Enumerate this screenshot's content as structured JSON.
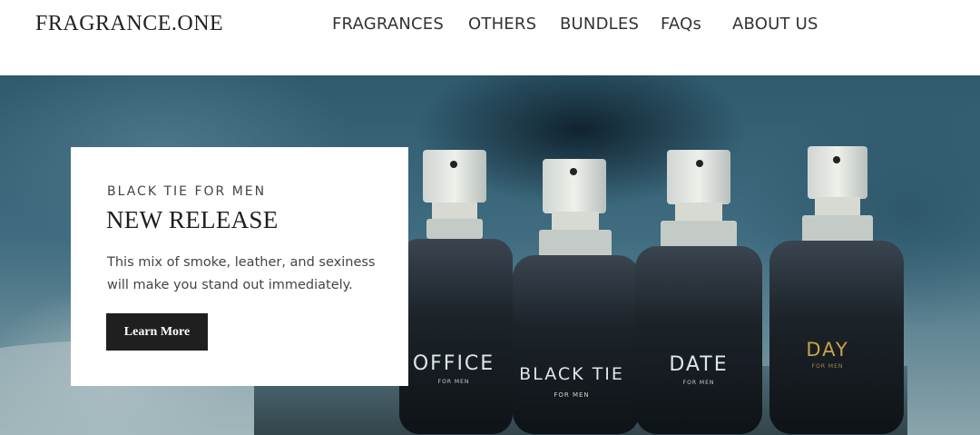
{
  "header": {
    "logo": "FRAGRANCE.ONE",
    "nav": [
      "FRAGRANCES",
      "OTHERS",
      "BUNDLES",
      "FAQs",
      "ABOUT US"
    ]
  },
  "hero": {
    "bottle_labels": [
      {
        "name": "OFFICE",
        "sub": "FOR MEN"
      },
      {
        "name": "BLACK TIE",
        "sub": "FOR MEN"
      },
      {
        "name": "DATE",
        "sub": "FOR MEN"
      },
      {
        "name": "DAY",
        "sub": "FOR MEN"
      }
    ]
  },
  "promo": {
    "eyebrow": "BLACK TIE FOR MEN",
    "title": "NEW RELEASE",
    "description": "This mix of smoke, leather, and sexiness will make you stand out immediately.",
    "button_label": "Learn More"
  },
  "colors": {
    "button_bg": "#1f1f1f",
    "hero_base": "#3f6c80"
  }
}
